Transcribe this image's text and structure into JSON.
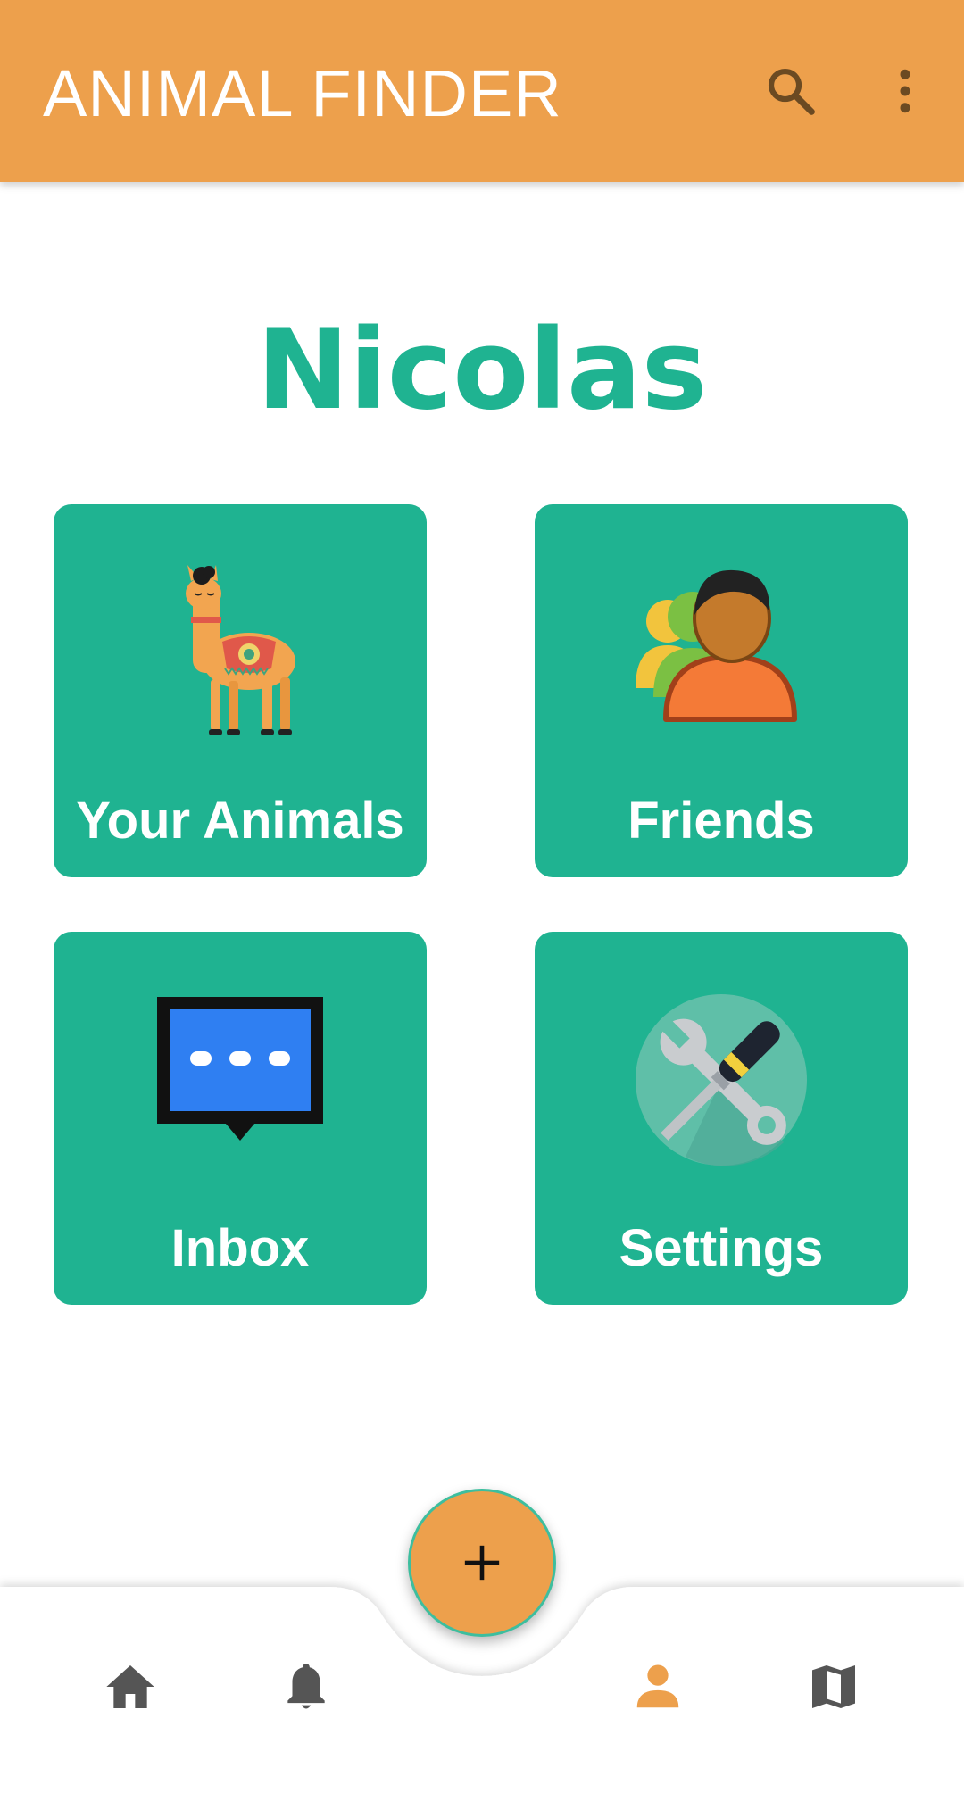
{
  "app_bar": {
    "title": "ANIMAL FINDER",
    "background": "#EDA04C",
    "actions": [
      {
        "icon": "search-icon"
      },
      {
        "icon": "more-vertical-icon"
      }
    ]
  },
  "profile": {
    "name": "Nicolas",
    "accent": "#1FB391"
  },
  "tiles": [
    {
      "label": "Your Animals",
      "icon": "llama-icon"
    },
    {
      "label": "Friends",
      "icon": "friends-icon"
    },
    {
      "label": "Inbox",
      "icon": "chat-bubble-icon"
    },
    {
      "label": "Settings",
      "icon": "tools-icon"
    }
  ],
  "fab": {
    "icon": "plus-icon",
    "color": "#EDA04C"
  },
  "bottom_nav": {
    "items": [
      {
        "icon": "home-icon",
        "active": false
      },
      {
        "icon": "bell-icon",
        "active": false
      },
      {
        "icon": "person-icon",
        "active": true
      },
      {
        "icon": "map-icon",
        "active": false
      }
    ],
    "active_color": "#EDA04C",
    "inactive_color": "#555555"
  }
}
